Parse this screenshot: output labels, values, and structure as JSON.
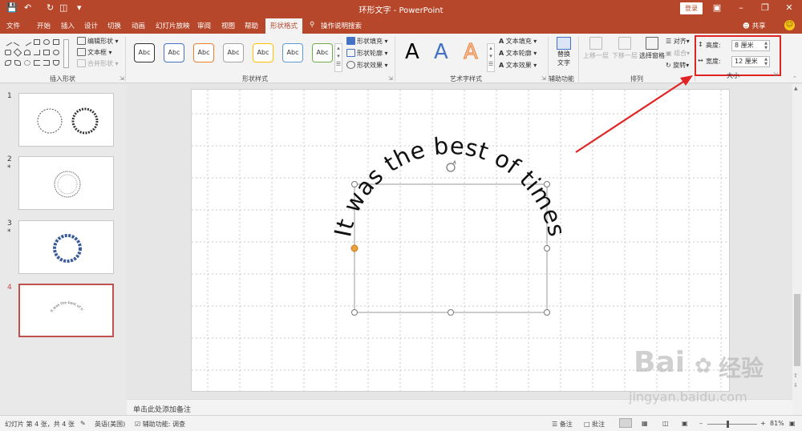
{
  "titlebar": {
    "title": "环形文字 - PowerPoint",
    "login": "登录",
    "save_icon": "save-icon",
    "undo_icon": "undo-icon",
    "redo_icon": "redo-icon"
  },
  "tabs": [
    {
      "label": "文件"
    },
    {
      "label": "开始"
    },
    {
      "label": "插入"
    },
    {
      "label": "设计"
    },
    {
      "label": "切换"
    },
    {
      "label": "动画"
    },
    {
      "label": "幻灯片放映"
    },
    {
      "label": "审阅"
    },
    {
      "label": "视图"
    },
    {
      "label": "帮助"
    },
    {
      "label": "形状格式"
    }
  ],
  "search_hint": "操作说明搜索",
  "share": "共享",
  "ribbon": {
    "insert_shapes": {
      "edit_shape": "编辑形状",
      "text_box": "文本框",
      "merge_shapes": "合并形状",
      "label": "插入形状"
    },
    "shape_styles": {
      "preview_text": "Abc",
      "boxes": [
        {
          "border": "#333333"
        },
        {
          "border": "#4472c4"
        },
        {
          "border": "#ed7d31"
        },
        {
          "border": "#a5a5a5"
        },
        {
          "border": "#ffc000"
        },
        {
          "border": "#5b9bd5"
        },
        {
          "border": "#70ad47"
        }
      ],
      "fill": "形状填充",
      "outline": "形状轮廓",
      "effects": "形状效果",
      "label": "形状样式"
    },
    "wordart": {
      "letter": "A",
      "fill": "文本填充",
      "outline": "文本轮廓",
      "effects": "文本效果",
      "label": "艺术字样式"
    },
    "accessibility": {
      "alt_text_1": "替换",
      "alt_text_2": "文字",
      "label": "辅助功能"
    },
    "arrange": {
      "bring_forward": "上移一层",
      "send_backward": "下移一层",
      "selection_pane": "选择窗格",
      "align": "对齐",
      "group": "组合",
      "rotate": "旋转",
      "label": "排列"
    },
    "size": {
      "height_label": "高度:",
      "height_value": "8 厘米",
      "width_label": "宽度:",
      "width_value": "12 厘米",
      "label": "大小"
    }
  },
  "slides": [
    {
      "number": "1",
      "star": ""
    },
    {
      "number": "2",
      "star": "*"
    },
    {
      "number": "3",
      "star": "*"
    },
    {
      "number": "4",
      "star": ""
    }
  ],
  "slide_text": "It was the best of times",
  "notes_placeholder": "单击此处添加备注",
  "status": {
    "slide_info": "幻灯片 第 4 张，共 4 张",
    "language": "英语(美国)",
    "accessibility": "辅助功能: 调查",
    "notes": "备注",
    "comments": "批注",
    "zoom": "81%"
  },
  "watermark": {
    "brand": "Bai",
    "brand2": "经验",
    "url": "jingyan.baidu.com"
  },
  "colors": {
    "accent": "#b7472a",
    "annotation": "#e02424"
  }
}
